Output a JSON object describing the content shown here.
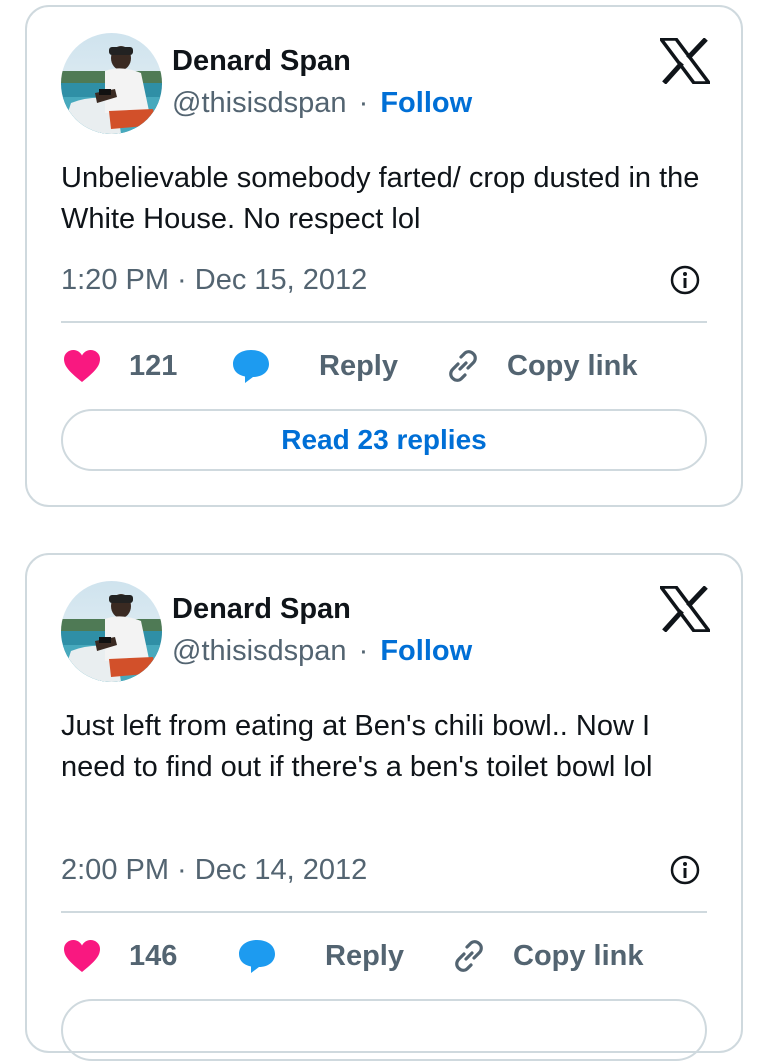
{
  "colors": {
    "like": "#f91880",
    "reply": "#1d9bf0",
    "link": "#006fd6",
    "muted": "#536471",
    "border": "#cfd9de"
  },
  "tweets": [
    {
      "author_name": "Denard Span",
      "handle": "@thisisdspan",
      "separator": "·",
      "follow_label": "Follow",
      "text": "Unbelievable somebody farted/ crop dusted in the White House. No respect lol",
      "timestamp": "1:20 PM · Dec 15, 2012",
      "like_count": "121",
      "reply_label": "Reply",
      "copy_link_label": "Copy link",
      "read_replies_label": "Read 23 replies",
      "icons": [
        "x-logo-icon",
        "info-icon",
        "heart-icon",
        "reply-bubble-icon",
        "link-icon"
      ]
    },
    {
      "author_name": "Denard Span",
      "handle": "@thisisdspan",
      "separator": "·",
      "follow_label": "Follow",
      "text": "Just left from eating at Ben's chili bowl.. Now I need to find out if there's a ben's toilet bowl lol",
      "timestamp": "2:00 PM · Dec 14, 2012",
      "like_count": "146",
      "reply_label": "Reply",
      "copy_link_label": "Copy link",
      "icons": [
        "x-logo-icon",
        "info-icon",
        "heart-icon",
        "reply-bubble-icon",
        "link-icon"
      ]
    }
  ]
}
